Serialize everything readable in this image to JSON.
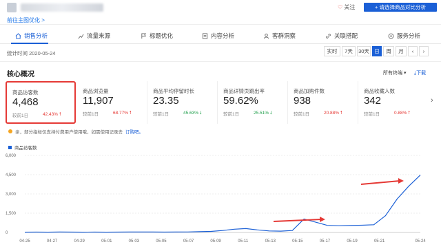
{
  "header": {
    "crumb": "前往主图优化 >",
    "follow_label": "关注",
    "compare_button": "+ 请选择商品对比分析"
  },
  "tabs": [
    {
      "label": "销售分析",
      "icon": "home-icon"
    },
    {
      "label": "流量来源",
      "icon": "trend-icon"
    },
    {
      "label": "标题优化",
      "icon": "flag-icon"
    },
    {
      "label": "内容分析",
      "icon": "doc-icon"
    },
    {
      "label": "客群洞察",
      "icon": "people-icon"
    },
    {
      "label": "关联搭配",
      "icon": "link-icon"
    },
    {
      "label": "服务分析",
      "icon": "service-icon"
    }
  ],
  "stat_time": "统计时间 2020-05-24",
  "periods": [
    "实时",
    "7天",
    "30天",
    "日",
    "周",
    "月"
  ],
  "active_period": "日",
  "core": {
    "title": "核心概况",
    "channel": "所有终端",
    "download": "下载"
  },
  "cards": [
    {
      "label": "商品访客数",
      "value": "4,468",
      "compare": "较前1日",
      "pct": "42.43%",
      "dir": "up"
    },
    {
      "label": "商品浏览量",
      "value": "11,907",
      "compare": "较前1日",
      "pct": "68.77%",
      "dir": "up"
    },
    {
      "label": "商品平均停留时长",
      "value": "23.35",
      "compare": "较前1日",
      "pct": "45.63%",
      "dir": "down"
    },
    {
      "label": "商品详情页跳出率",
      "value": "59.62%",
      "compare": "较前1日",
      "pct": "25.51%",
      "dir": "down"
    },
    {
      "label": "商品加购件数",
      "value": "938",
      "compare": "较前1日",
      "pct": "20.88%",
      "dir": "up"
    },
    {
      "label": "商品收藏人数",
      "value": "342",
      "compare": "较前1日",
      "pct": "0.88%",
      "dir": "up"
    }
  ],
  "notice": {
    "text": "亲，部分指标仅支持付费用户使用哦，如需使用记录去",
    "link": "订购吧。"
  },
  "colors": {
    "accent": "#1a5fd6",
    "up": "#e53935",
    "down": "#1e9e4a",
    "arrow": "#e53935"
  },
  "chart_data": {
    "type": "line",
    "series": [
      {
        "name": "商品访客数",
        "values": [
          20,
          25,
          20,
          30,
          25,
          20,
          25,
          20,
          25,
          30,
          30,
          30,
          25,
          30,
          40,
          60,
          80,
          150,
          250,
          300,
          200,
          120,
          100,
          150,
          1050,
          800,
          550,
          520,
          540,
          560,
          600,
          1300,
          2600,
          3600,
          4468
        ]
      }
    ],
    "x": [
      "04-25",
      "04-26",
      "04-27",
      "04-28",
      "04-29",
      "04-30",
      "05-01",
      "05-02",
      "05-03",
      "05-04",
      "05-05",
      "05-06",
      "05-07",
      "05-08",
      "05-09",
      "05-10",
      "05-11",
      "05-12",
      "05-13",
      "05-14",
      "05-15",
      "05-16",
      "05-17",
      "05-18",
      "05-19",
      "05-20",
      "05-21",
      "05-22",
      "05-23",
      "05-24"
    ],
    "xticks": [
      "04-25",
      "04-27",
      "04-29",
      "05-01",
      "05-03",
      "05-05",
      "05-07",
      "05-09",
      "05-11",
      "05-13",
      "05-15",
      "05-17",
      "05-19",
      "05-21",
      "05-24"
    ],
    "yticks": [
      "0",
      "1,500",
      "3,000",
      "4,500",
      "6,000"
    ],
    "ylim": [
      0,
      6000
    ],
    "legend": "top-left"
  }
}
